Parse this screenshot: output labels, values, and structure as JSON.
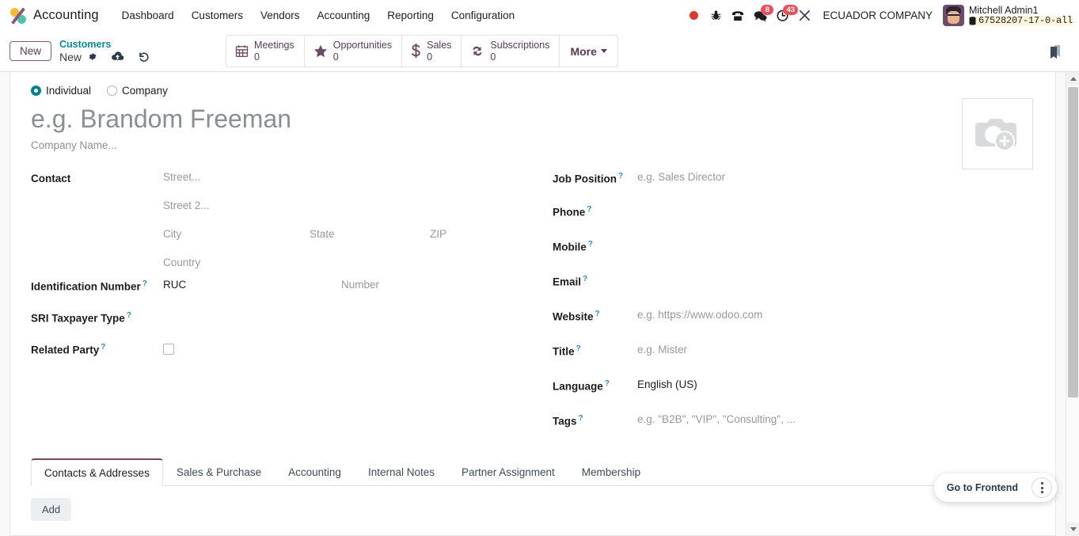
{
  "navbar": {
    "brand": "Accounting",
    "brand_logo_icon": "odoo-accounting-logo-icon",
    "menu": [
      {
        "label": "Dashboard"
      },
      {
        "label": "Customers"
      },
      {
        "label": "Vendors"
      },
      {
        "label": "Accounting"
      },
      {
        "label": "Reporting"
      },
      {
        "label": "Configuration"
      }
    ],
    "systray": {
      "record_icon": "record-dot-icon",
      "debug_icon": "bug-icon",
      "voip_icon": "phone-icon",
      "messages_icon": "chat-bubble-icon",
      "messages_count": "8",
      "activities_icon": "clock-icon",
      "activities_count": "43",
      "tools_icon": "wrench-icon",
      "company": "ECUADOR COMPANY",
      "user_name": "Mitchell Admin1",
      "database": "67528207-17-0-all",
      "database_icon": "database-icon",
      "avatar_icon": "user-avatar"
    }
  },
  "control_panel": {
    "new_button": "New",
    "breadcrumb_parent": "Customers",
    "breadcrumb_current": "New",
    "gear_icon": "gear-icon",
    "save_icon": "cloud-upload-icon",
    "discard_icon": "undo-icon",
    "bookmark_icon": "bookmark-icon",
    "stat_buttons": [
      {
        "label": "Meetings",
        "value": "0",
        "icon": "calendar-icon"
      },
      {
        "label": "Opportunities",
        "value": "0",
        "icon": "star-icon"
      },
      {
        "label": "Sales",
        "value": "0",
        "icon": "dollar-icon"
      },
      {
        "label": "Subscriptions",
        "value": "0",
        "icon": "refresh-icon"
      }
    ],
    "more_label": "More"
  },
  "form": {
    "partner_type": {
      "individual": "Individual",
      "company": "Company",
      "selected": "Individual"
    },
    "name_placeholder": "e.g. Brandom Freeman",
    "company_name_placeholder": "Company Name...",
    "photo_icon": "camera-add-icon",
    "left": {
      "contact_label": "Contact",
      "street_placeholder": "Street...",
      "street2_placeholder": "Street 2...",
      "city_placeholder": "City",
      "state_placeholder": "State",
      "zip_placeholder": "ZIP",
      "country_placeholder": "Country",
      "identification_number_label": "Identification Number",
      "identification_type_value": "RUC",
      "identification_number_placeholder": "Number",
      "sri_taxpayer_type_label": "SRI Taxpayer Type",
      "sri_taxpayer_type_value": "",
      "related_party_label": "Related Party",
      "related_party_checked": false
    },
    "right": [
      {
        "label": "Job Position",
        "value": "",
        "placeholder": "e.g. Sales Director",
        "help": true
      },
      {
        "label": "Phone",
        "value": "",
        "placeholder": "",
        "help": true
      },
      {
        "label": "Mobile",
        "value": "",
        "placeholder": "",
        "help": true
      },
      {
        "label": "Email",
        "value": "",
        "placeholder": "",
        "help": true
      },
      {
        "label": "Website",
        "value": "",
        "placeholder": "e.g. https://www.odoo.com",
        "help": true
      },
      {
        "label": "Title",
        "value": "",
        "placeholder": "e.g. Mister",
        "help": true
      },
      {
        "label": "Language",
        "value": "English (US)",
        "placeholder": "",
        "help": true
      },
      {
        "label": "Tags",
        "value": "",
        "placeholder": "e.g. \"B2B\", \"VIP\", \"Consulting\", ...",
        "help": true
      }
    ],
    "tabs": [
      {
        "label": "Contacts & Addresses",
        "active": true
      },
      {
        "label": "Sales & Purchase",
        "active": false
      },
      {
        "label": "Accounting",
        "active": false
      },
      {
        "label": "Internal Notes",
        "active": false
      },
      {
        "label": "Partner Assignment",
        "active": false
      },
      {
        "label": "Membership",
        "active": false
      }
    ],
    "add_button": "Add"
  },
  "frontend_widget": {
    "label": "Go to Frontend",
    "menu_icon": "vertical-dots-icon"
  },
  "colors": {
    "brand_purple": "#714b67",
    "accent_teal": "#00808f",
    "badge_red": "#e8505b",
    "link_blue": "#2d8ab5"
  }
}
